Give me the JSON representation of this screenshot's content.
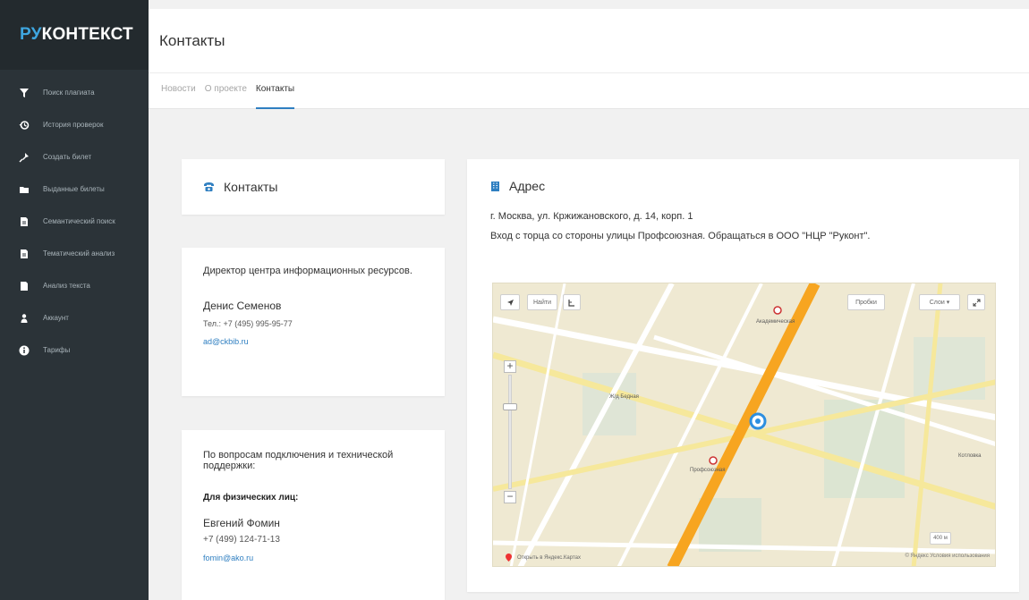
{
  "brand": {
    "prefix": "РУ",
    "rest": "КОНТЕКСТ"
  },
  "sidebar": {
    "items": [
      {
        "label": "Поиск плагиата",
        "icon": "filter-icon"
      },
      {
        "label": "История проверок",
        "icon": "history-icon"
      },
      {
        "label": "Создать билет",
        "icon": "pin-icon"
      },
      {
        "label": "Выданные билеты",
        "icon": "folder-icon"
      },
      {
        "label": "Семантический поиск",
        "icon": "document-icon"
      },
      {
        "label": "Тематический анализ",
        "icon": "document-icon"
      },
      {
        "label": "Анализ текста",
        "icon": "document-icon"
      },
      {
        "label": "Аккаунт",
        "icon": "user-icon"
      },
      {
        "label": "Тарифы",
        "icon": "info-icon"
      }
    ]
  },
  "header": {
    "title": "Контакты"
  },
  "tabs": [
    {
      "label": "Новости",
      "active": false
    },
    {
      "label": "О проекте",
      "active": false
    },
    {
      "label": "Контакты",
      "active": true
    }
  ],
  "contacts": {
    "title": "Контакты",
    "director": {
      "role": "Директор центра информационных ресурсов.",
      "name": "Денис Семенов",
      "phone": "Тел.: +7 (495) 995-95-77",
      "email": "ad@ckbib.ru"
    },
    "support": {
      "intro": "По вопросам подключения и технической поддержки:",
      "group": "Для физических лиц:",
      "name": "Евгений Фомин",
      "phone": "+7 (499) 124-71-13",
      "email": "fomin@ako.ru"
    }
  },
  "address": {
    "title": "Адрес",
    "line1": "г. Москва, ул. Кржижановского, д. 14, корп. 1",
    "line2": "Вход с торца со стороны улицы Профсоюзная. Обращаться в ООО \"НЦР \"Руконт\"."
  },
  "map": {
    "find_label": "Найти",
    "traffic_label": "Пробки",
    "layers_label": "Слои",
    "open_label": "Открыть в Яндекс.Картах",
    "copyright": "© Яндекс  Условия использования",
    "scale": "400 м",
    "labels": {
      "akademicheskaya": "Академическая",
      "profsoyuznaya": "Профсоюзная",
      "station": "Ж/д Бедная",
      "kotlovka": "Котловка"
    }
  },
  "colors": {
    "sidebar_bg": "#2b3338",
    "accent": "#2f7fc1",
    "road_main": "#f5a623"
  }
}
